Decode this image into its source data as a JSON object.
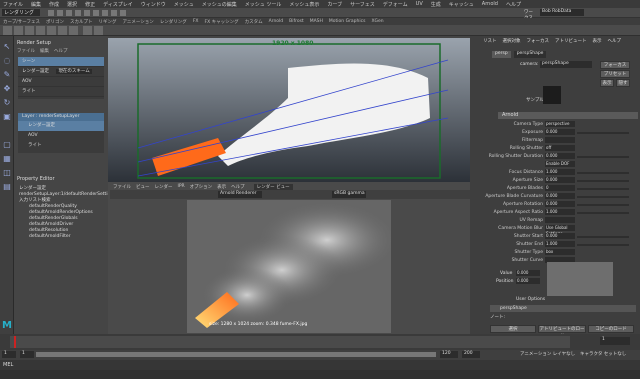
{
  "menubar": [
    "ファイル",
    "編集",
    "作成",
    "選択",
    "修正",
    "ディスプレイ",
    "ウィンドウ",
    "メッシュ",
    "メッシュの編集",
    "メッシュ ツール",
    "メッシュ表示",
    "カーブ",
    "サーフェス",
    "デフォーム",
    "UV",
    "生成",
    "キャッシュ",
    "Arnold",
    "ヘルプ"
  ],
  "workspace_label": "ワークスペース",
  "workspace_value": "Bob RobData",
  "mode_dropdown": "レンダリング",
  "shelf_tabs": [
    "カーブ/サーフェス",
    "ポリゴン",
    "スカルプト",
    "リギング",
    "アニメーション",
    "レンダリング",
    "FX",
    "FX キャッシング",
    "カスタム",
    "Arnold",
    "Bifrost",
    "MASH",
    "Motion Graphics",
    "XGen"
  ],
  "render_setup": {
    "title": "Render Setup",
    "menu": [
      "ファイル",
      "編集",
      "ヘルプ"
    ],
    "tree": [
      "シーン",
      "レンダー設定",
      "AOV",
      "ライト"
    ],
    "tree_right": "現在のスキーム",
    "layer": "Layer : renderSetupLayer",
    "layer_items": [
      "レンダー設定",
      "AOV",
      "ライト"
    ]
  },
  "property_editor": {
    "title": "Property Editor",
    "header": "レンダー設定",
    "path": "renderSetupLayer:1/defaultRenderSettings",
    "collection": "入力リスト検索",
    "items": [
      "defaultRenderQuality",
      "defaultArnoldRenderOptions",
      "defaultRenderGlobals",
      "defaultArnoldDriver",
      "defaultResolution",
      "defaultArnoldFilter"
    ]
  },
  "viewport": {
    "top_label": "1920 x 1080",
    "menu": [
      "ファイル",
      "ビュー",
      "レンダー",
      "IPR",
      "オプション",
      "表示",
      "ヘルプ"
    ],
    "tab": "レンダー ビュー",
    "renderer": "Arnold Renderer",
    "gamma": "sRGB gamma",
    "caption": "size: 1280 x 1024  zoom: 0.348  fume-FX.jpg"
  },
  "attribute_editor": {
    "tabs": [
      "リスト",
      "選択対象",
      "フォーカス",
      "アトリビュート",
      "表示",
      "ヘルプ"
    ],
    "node_tabs": [
      "persp",
      "perspShape"
    ],
    "camera_label": "camera:",
    "camera_value": "perspShape",
    "focus_button": "フォーカス",
    "preset_button": "プリセット",
    "show_button": "表示",
    "hide_button": "隠す",
    "sample_label": "サンプル",
    "section": "Arnold",
    "rows": [
      {
        "label": "Camera Type",
        "value": "perspective"
      },
      {
        "label": "Exposure",
        "value": "0.000"
      },
      {
        "label": "Filtermap",
        "value": ""
      },
      {
        "label": "Rolling Shutter",
        "value": "off"
      },
      {
        "label": "Rolling Shutter Duration",
        "value": "0.000"
      },
      {
        "label": "",
        "value": "Enable DOF"
      },
      {
        "label": "Focus Distance",
        "value": "1.000"
      },
      {
        "label": "Aperture Size",
        "value": "0.000"
      },
      {
        "label": "Aperture Blades",
        "value": "0"
      },
      {
        "label": "Aperture Blade Curvature",
        "value": "0.000"
      },
      {
        "label": "Aperture Rotation",
        "value": "0.000"
      },
      {
        "label": "Aperture Aspect Ratio",
        "value": "1.000"
      },
      {
        "label": "UV Remap",
        "value": ""
      },
      {
        "label": "Camera Motion Blur",
        "value": "Use Global Settings"
      },
      {
        "label": "Shutter Start",
        "value": "0.000"
      },
      {
        "label": "Shutter End",
        "value": "1.000"
      },
      {
        "label": "Shutter Type",
        "value": "box"
      },
      {
        "label": "Shutter Curve",
        "value": ""
      }
    ],
    "value_label": "Value",
    "value_value": "0.000",
    "position_label": "Position",
    "position_value": "0.000",
    "user_options": "User Options",
    "perspshape_label": "perspShape",
    "notes_label": "ノート:",
    "bottom_buttons": [
      "選択",
      "アトリビュートのロード",
      "コピーのロード"
    ]
  },
  "timeline": {
    "start": "1",
    "end": "120",
    "range_start": "1",
    "range_end": "120",
    "max_end": "200",
    "current": "1",
    "anim_layer": "アニメーション レイヤなし",
    "char_set": "キャラクタ セットなし",
    "fps": "24 fps"
  },
  "command_line": "MEL"
}
